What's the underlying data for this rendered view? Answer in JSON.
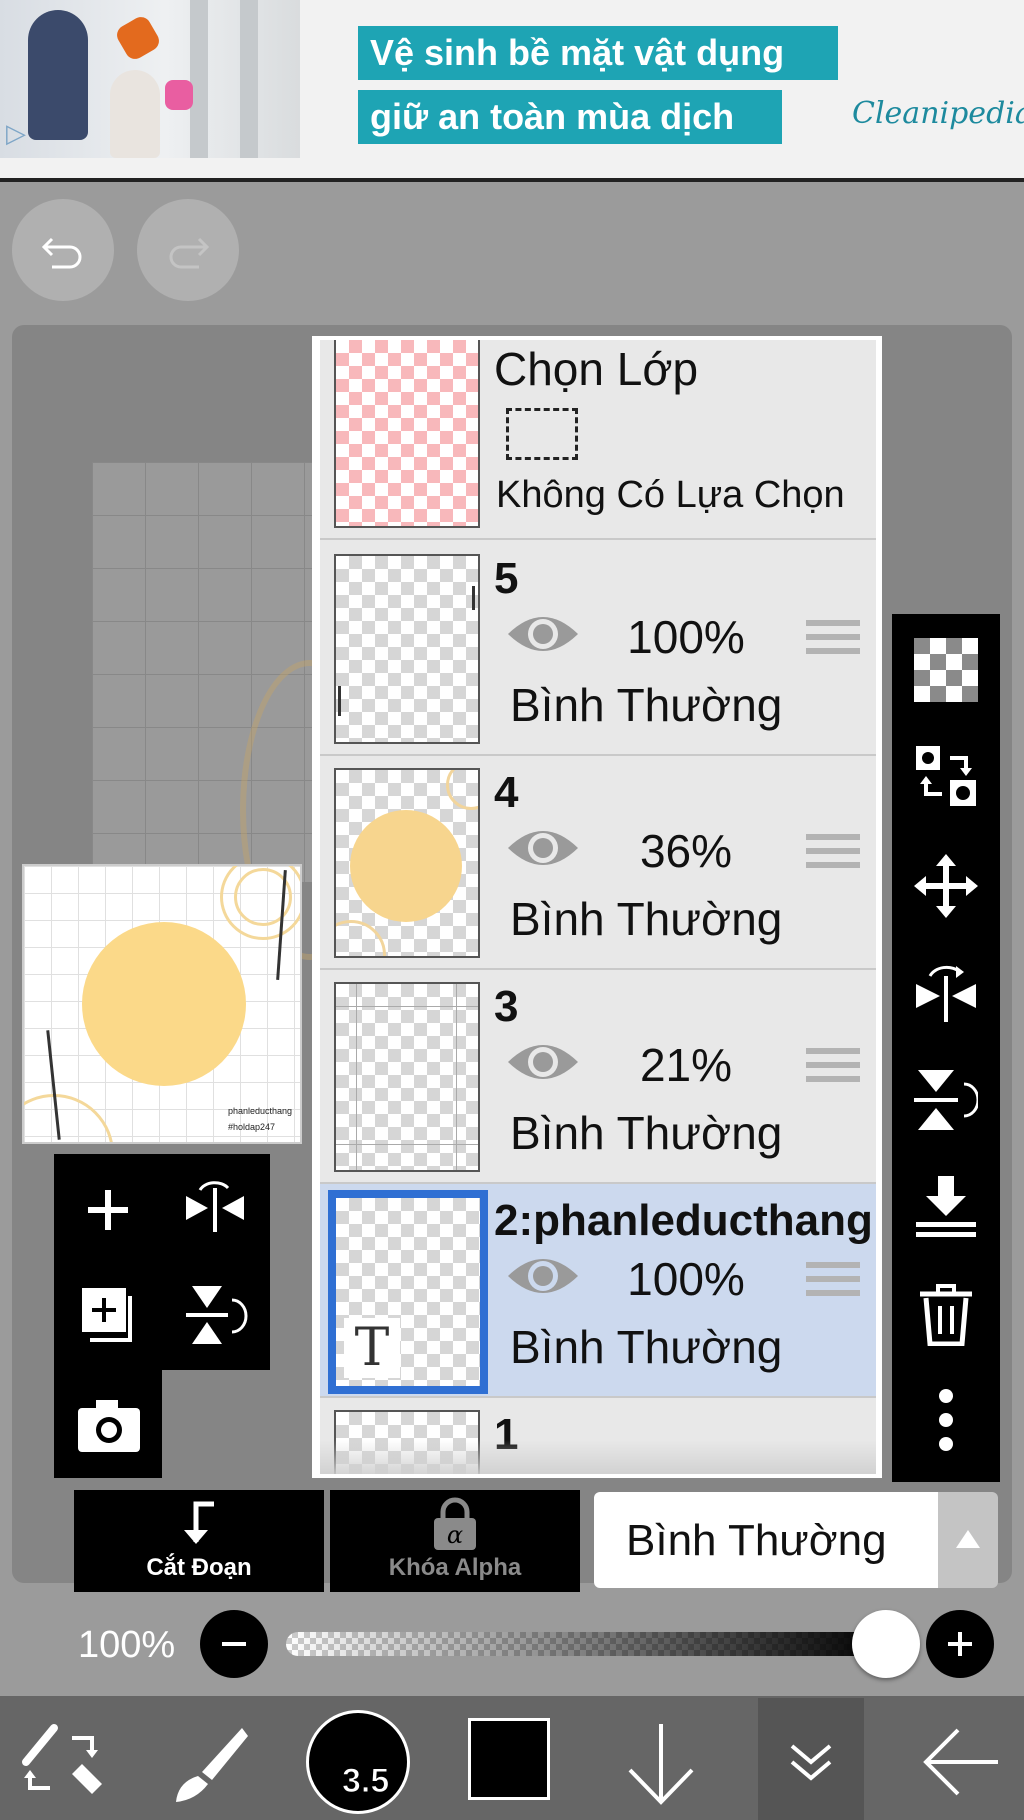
{
  "ad": {
    "line1": "Vệ sinh bề mặt vật dụng",
    "line2": "giữ an toàn mùa dịch",
    "brand": "Cleanipedia"
  },
  "toolbar_top": {
    "undo_icon": "undo-icon",
    "redo_icon": "redo-icon"
  },
  "preview": {
    "text1": "phanleducthang",
    "text2": "#holdap247"
  },
  "layers_panel": {
    "selection_layer": {
      "title": "Chọn Lớp",
      "status": "Không Có Lựa Chọn"
    },
    "layers": [
      {
        "name": "5",
        "opacity": "100%",
        "blend": "Bình Thường",
        "selected": false
      },
      {
        "name": "4",
        "opacity": "36%",
        "blend": "Bình Thường",
        "selected": false
      },
      {
        "name": "3",
        "opacity": "21%",
        "blend": "Bình Thường",
        "selected": false
      },
      {
        "name": "2:phanleducthang",
        "opacity": "100%",
        "blend": "Bình Thường",
        "selected": true,
        "type_marker": "T"
      },
      {
        "name": "1"
      }
    ]
  },
  "controls": {
    "clipping_label": "Cắt Đoạn",
    "alpha_lock_label": "Khóa Alpha",
    "blend_mode": "Bình Thường",
    "opacity_label": "100%",
    "opacity_value": 1.0
  },
  "bottom_bar": {
    "brush_size": "3.5",
    "current_color": "#000000"
  },
  "colors": {
    "selected_layer_bg": "#ccd9ee",
    "selected_border": "#2f6fd3",
    "ad_teal": "#1ea4b4"
  }
}
